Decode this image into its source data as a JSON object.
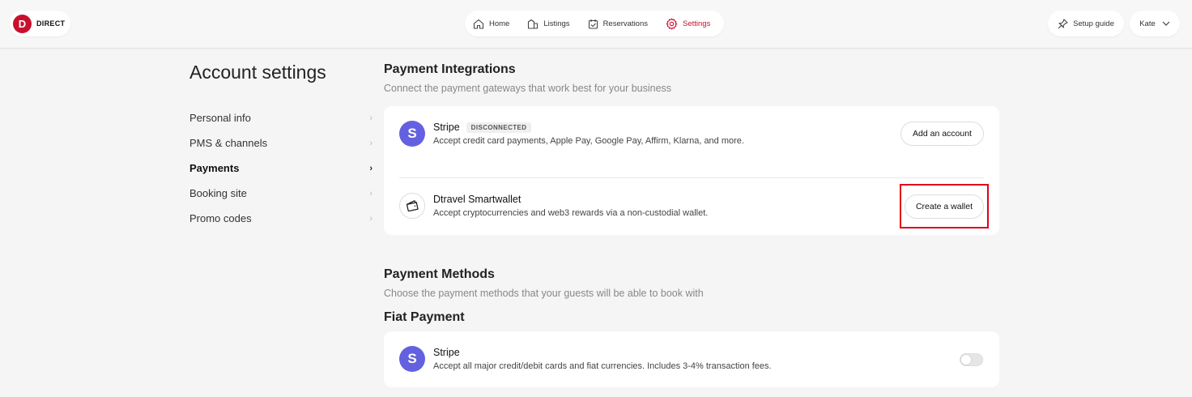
{
  "brand": {
    "logo_letter": "D",
    "name": "DIRECT",
    "color": "#c8102e"
  },
  "nav": {
    "items": [
      {
        "label": "Home",
        "icon": "home-icon"
      },
      {
        "label": "Listings",
        "icon": "listings-icon"
      },
      {
        "label": "Reservations",
        "icon": "calendar-icon"
      },
      {
        "label": "Settings",
        "icon": "gear-icon",
        "active": true
      }
    ]
  },
  "header": {
    "setup_guide": "Setup guide",
    "user_name": "Kate"
  },
  "sidebar": {
    "title": "Account settings",
    "items": [
      {
        "label": "Personal info"
      },
      {
        "label": "PMS & channels"
      },
      {
        "label": "Payments",
        "active": true
      },
      {
        "label": "Booking site"
      },
      {
        "label": "Promo codes"
      }
    ]
  },
  "integrations": {
    "title": "Payment Integrations",
    "subtitle": "Connect the payment gateways that work best for your business",
    "stripe": {
      "icon_letter": "S",
      "name": "Stripe",
      "badge": "DISCONNECTED",
      "description": "Accept credit card payments, Apple Pay, Google Pay, Affirm, Klarna, and more.",
      "button": "Add an account"
    },
    "wallet": {
      "name": "Dtravel Smartwallet",
      "description": "Accept cryptocurrencies and web3 rewards via a non-custodial wallet.",
      "button": "Create a wallet"
    }
  },
  "methods": {
    "title": "Payment Methods",
    "subtitle": "Choose the payment methods that your guests will be able to book with",
    "fiat_title": "Fiat Payment",
    "stripe": {
      "icon_letter": "S",
      "name": "Stripe",
      "description": "Accept all major credit/debit cards and fiat currencies. Includes 3-4% transaction fees.",
      "enabled": false
    }
  },
  "colors": {
    "accent": "#c8102e",
    "stripe": "#6461e0",
    "highlight": "#e0001b"
  }
}
